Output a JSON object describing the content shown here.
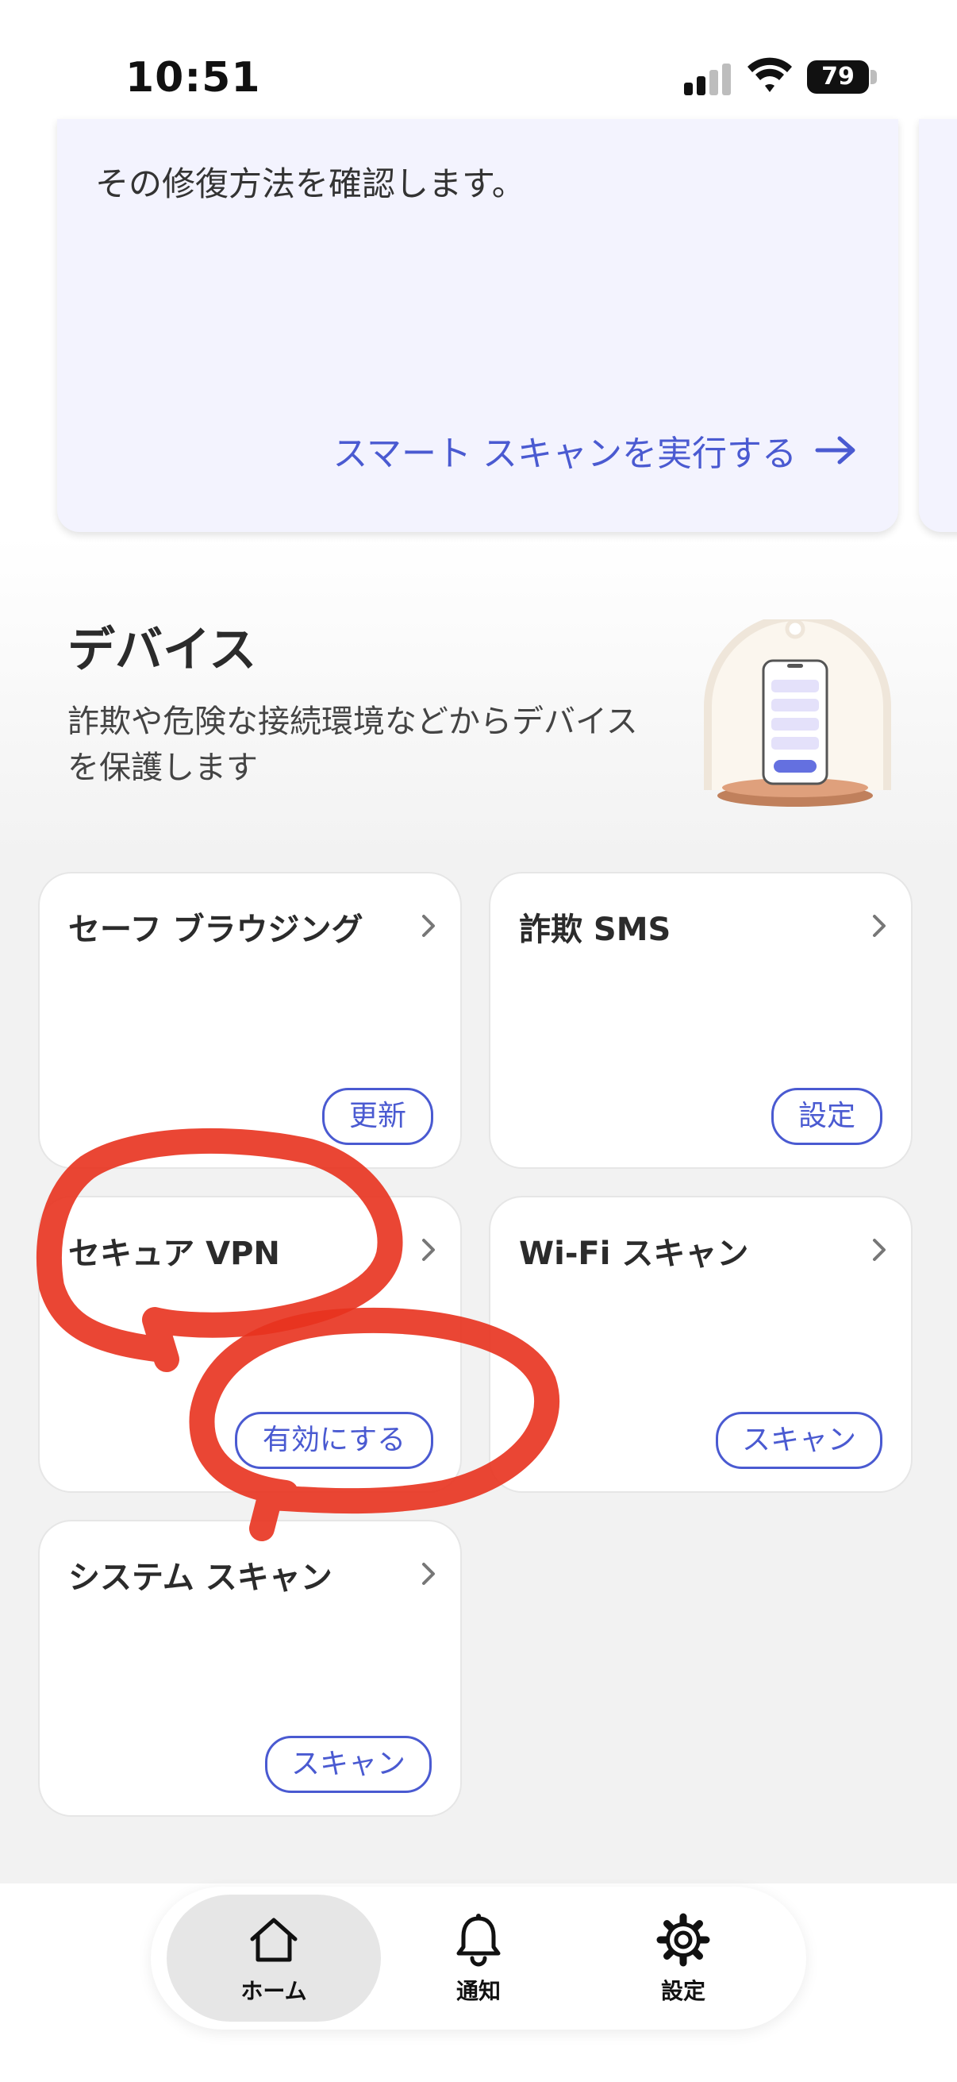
{
  "status_bar": {
    "time": "10:51",
    "battery": "79",
    "icons": [
      "signal-icon",
      "wifi-icon",
      "battery-icon"
    ]
  },
  "top_card": {
    "text": "その修復方法を確認します。",
    "action_label": "スマート スキャンを実行する",
    "action_icon": "arrow-right-icon"
  },
  "device_section": {
    "title": "デバイス",
    "description": "詐欺や危険な接続環境などからデバイスを保護します",
    "illustration": "phone-illustration"
  },
  "tiles": [
    {
      "title": "セーフ ブラウジング",
      "button": "更新"
    },
    {
      "title": "詐欺 SMS",
      "button": "設定"
    },
    {
      "title": "セキュア VPN",
      "button": "有効にする"
    },
    {
      "title": "Wi-Fi スキャン",
      "button": "スキャン"
    },
    {
      "title": "システム スキャン",
      "button": "スキャン"
    }
  ],
  "annotation": {
    "color": "#e8321e",
    "description": "red-hand-drawn-circles"
  },
  "bottom_nav": {
    "items": [
      {
        "label": "ホーム",
        "icon": "home-icon",
        "active": true
      },
      {
        "label": "通知",
        "icon": "bell-icon",
        "active": false
      },
      {
        "label": "設定",
        "icon": "gear-icon",
        "active": false
      }
    ]
  },
  "colors": {
    "accent": "#4a5ad1",
    "card_tint": "#f3f3fe",
    "background": "#f2f2f2"
  }
}
